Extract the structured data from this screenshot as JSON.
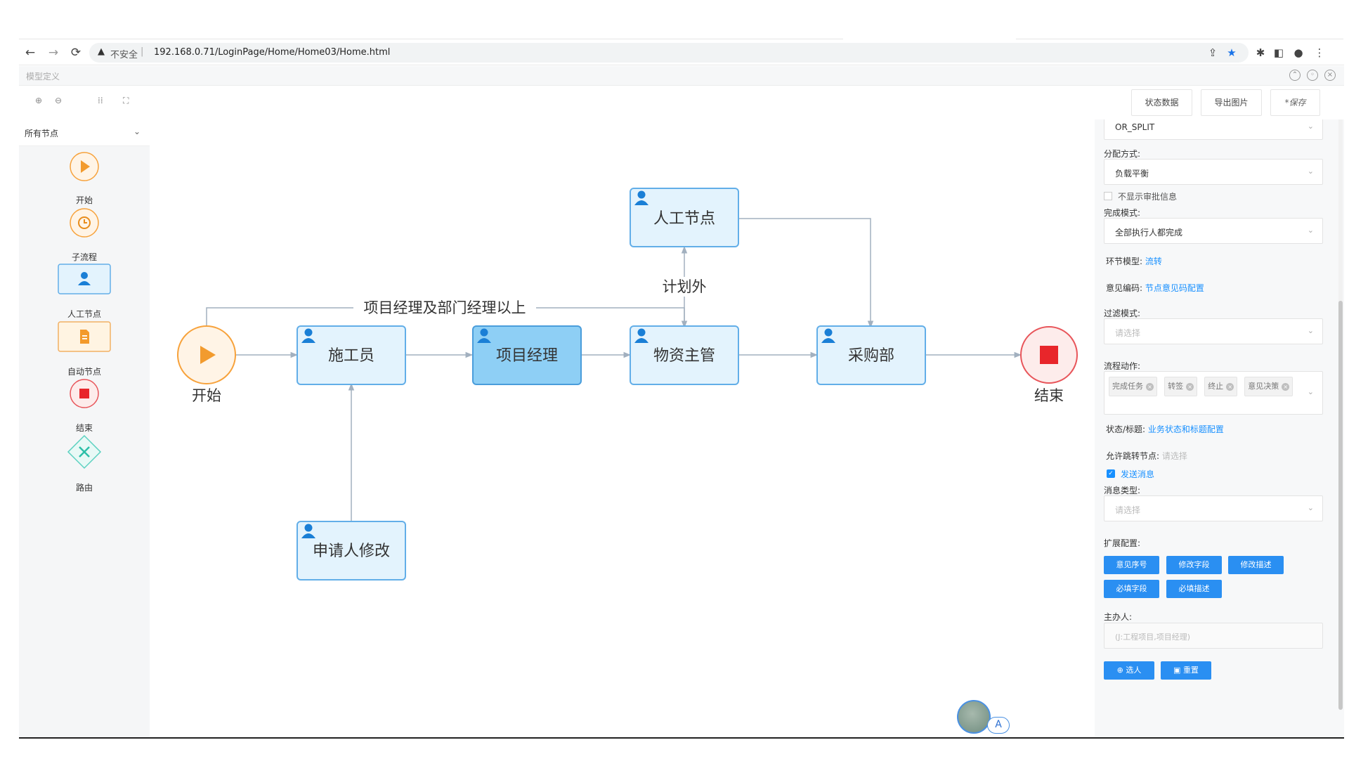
{
  "browser": {
    "insecure_label": "不安全",
    "separator": "|",
    "url": "192.168.0.71/LoginPage/Home/Home03/Home.html"
  },
  "app": {
    "title": "模型定义"
  },
  "toolbar": {
    "status_data": "状态数据",
    "export_image": "导出图片",
    "save": "*保存"
  },
  "palette": {
    "title": "所有节点",
    "items": [
      {
        "label": "开始",
        "icon": "play-icon"
      },
      {
        "label": "子流程",
        "icon": "clock-icon"
      },
      {
        "label": "人工节点",
        "icon": "user-icon"
      },
      {
        "label": "自动节点",
        "icon": "document-icon"
      },
      {
        "label": "结束",
        "icon": "stop-icon"
      },
      {
        "label": "路由",
        "icon": "route-icon"
      }
    ]
  },
  "diagram": {
    "nodes": {
      "start": "开始",
      "worker": "施工员",
      "pm": "项目经理",
      "material": "物资主管",
      "purchase": "采购部",
      "end": "结束",
      "manual": "人工节点",
      "applicant": "申请人修改"
    },
    "edge_labels": {
      "manager_path": "项目经理及部门经理以上",
      "unplanned": "计划外"
    }
  },
  "props": {
    "split_value": "OR_SPLIT",
    "assign_label": "分配方式:",
    "assign_value": "负载平衡",
    "hide_approval": "不显示审批信息",
    "complete_label": "完成模式:",
    "complete_value": "全部执行人都完成",
    "step_model_label": "环节模型:",
    "step_model_link": "流转",
    "opinion_code_label": "意见编码:",
    "opinion_code_link": "节点意见码配置",
    "filter_label": "过滤模式:",
    "filter_placeholder": "请选择",
    "action_label": "流程动作:",
    "actions": [
      "完成任务",
      "转签",
      "终止",
      "意见决策"
    ],
    "status_label": "状态/标题:",
    "status_link": "业务状态和标题配置",
    "jump_label": "允许跳转节点:",
    "jump_placeholder": "请选择",
    "send_msg": "发送消息",
    "msg_type_label": "消息类型:",
    "msg_type_placeholder": "请选择",
    "ext_label": "扩展配置:",
    "ext_buttons": [
      "意见序号",
      "修改字段",
      "修改描述",
      "必填字段",
      "必填描述"
    ],
    "owner_label": "主办人:",
    "owner_placeholder": "(J:工程项目,项目经理)",
    "select_person": "选人",
    "reset": "重置"
  },
  "avatar_badge": "A",
  "colors": {
    "accent": "#1890ff",
    "node_fill": "#e3f3fd",
    "node_border": "#62aee8",
    "node_selected": "#8ecff5",
    "start_orange": "#f7a23b",
    "end_red": "#e8262b"
  }
}
